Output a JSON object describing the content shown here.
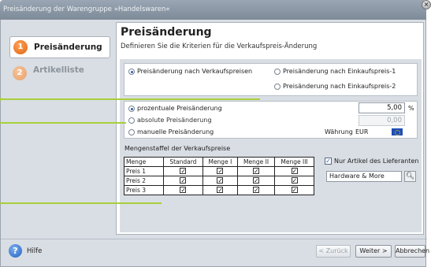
{
  "window": {
    "title": "Preisänderung der Warengruppe »Handelswaren«"
  },
  "sidebar": {
    "steps": [
      {
        "number": "1",
        "label": "Preisänderung",
        "state": "active"
      },
      {
        "number": "2",
        "label": "Artikelliste",
        "state": "inactive"
      }
    ]
  },
  "header": {
    "title": "Preisänderung",
    "subtitle": "Definieren Sie die Kriterien für die Verkaufspreis-Änderung"
  },
  "basis": {
    "option_vk": "Preisänderung nach Verkaufspreisen",
    "option_ek1": "Preisänderung nach Einkaufspreis-1",
    "option_ek2": "Preisänderung nach Einkaufspreis-2",
    "selected": "option_vk"
  },
  "change": {
    "percent_label": "prozentuale Preisänderung",
    "percent_value": "5,00",
    "percent_unit": "%",
    "absolute_label": "absolute Preisänderung",
    "absolute_value": "0,00",
    "manual_label": "manuelle Preisänderung",
    "currency_label": "Währung",
    "currency_value": "EUR",
    "selected": "percent"
  },
  "quantity": {
    "title": "Mengenstaffel der Verkaufspreise",
    "headers": [
      "Menge",
      "Standard",
      "Menge I",
      "Menge II",
      "Menge III"
    ],
    "rows": [
      {
        "label": "Preis 1",
        "checks": [
          true,
          true,
          true,
          true
        ]
      },
      {
        "label": "Preis 2",
        "checks": [
          true,
          true,
          true,
          true
        ]
      },
      {
        "label": "Preis 3",
        "checks": [
          true,
          true,
          true,
          true
        ]
      }
    ]
  },
  "supplier": {
    "checkbox_label": "Nur Artikel des Lieferanten",
    "checked": true,
    "value": "Hardware & More"
  },
  "footer": {
    "help_label": "Hilfe",
    "back_label": "< Zurück",
    "next_label": "Weiter >",
    "cancel_label": "Abbrechen"
  },
  "colors": {
    "accent_orange": "#e0620e",
    "callout_green": "#a9cf3a",
    "selection_blue": "#2b5fb0"
  }
}
